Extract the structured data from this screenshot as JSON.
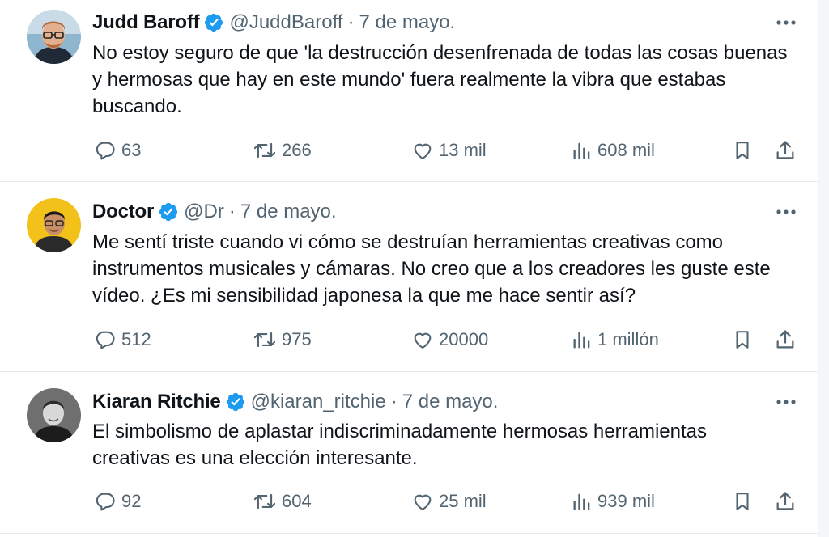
{
  "tweets": [
    {
      "name": "Judd Baroff",
      "handle": "@JuddBaroff",
      "separator": "·",
      "date": "7 de mayo.",
      "text": "No estoy seguro de que 'la destrucción desenfrenada de todas las cosas buenas y hermosas que hay en este mundo' fuera realmente la vibra que estabas buscando.",
      "replies": "63",
      "retweets": "266",
      "likes": "13 mil",
      "views": "608 mil"
    },
    {
      "name": "Doctor",
      "handle": "@Dr",
      "separator": "·",
      "date": "7 de mayo.",
      "text": "Me sentí triste cuando vi cómo se destruían herramientas creativas como instrumentos musicales y cámaras. No creo que a los creadores les guste este vídeo. ¿Es mi sensibilidad japonesa la que me hace sentir así?",
      "replies": "512",
      "retweets": "975",
      "likes": "20000",
      "views": "1 millón"
    },
    {
      "name": "Kiaran Ritchie",
      "handle": "@kiaran_ritchie",
      "separator": "·",
      "date": "7 de mayo.",
      "text": "El simbolismo de aplastar indiscriminadamente hermosas herramientas creativas es una elección interesante.",
      "replies": "92",
      "retweets": "604",
      "likes": "25 mil",
      "views": "939 mil"
    }
  ],
  "colors": {
    "text": "#0f1419",
    "muted": "#536471",
    "verified": "#1d9bf0",
    "divider": "#e6e9eb"
  },
  "icons": [
    "verified-badge-icon",
    "more-icon",
    "reply-icon",
    "retweet-icon",
    "like-icon",
    "views-icon",
    "bookmark-icon",
    "share-icon"
  ]
}
